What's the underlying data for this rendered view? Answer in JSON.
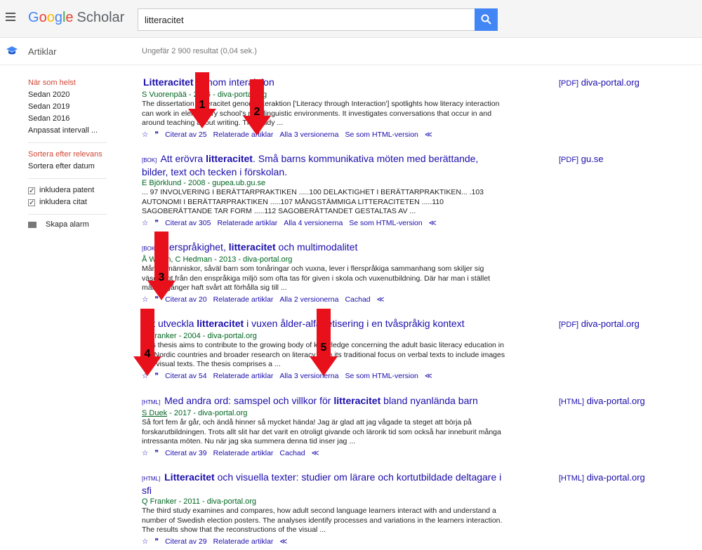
{
  "header": {
    "logo_google": [
      "G",
      "o",
      "o",
      "g",
      "l",
      "e"
    ],
    "logo_scholar": "Scholar",
    "search_value": "litteracitet"
  },
  "subheader": {
    "section": "Artiklar",
    "result_count": "Ungefär 2 900 resultat (0,04 sek.)"
  },
  "sidebar": {
    "time_filters": [
      "När som helst",
      "Sedan 2020",
      "Sedan 2019",
      "Sedan 2016",
      "Anpassat intervall ..."
    ],
    "sort_options": [
      "Sortera efter relevans",
      "Sortera efter datum"
    ],
    "checkboxes": [
      "inkludera patent",
      "inkludera citat"
    ],
    "alarm": "Skapa alarm"
  },
  "results": [
    {
      "tag": "",
      "title_pre": "",
      "title_bold": "Litteracitet",
      "title_post": " genom interaktion",
      "author": "S Vuorenpää - 2016 - diva-portal.org",
      "author_link": "",
      "snippet": "The dissertation Litteracitet genom interaktion ['Literacy through Interaction'] spotlights how literacy interaction can work in elementary school's multilinguistic environments. It investigates conversations that occur in and around teaching about writing. The study ...",
      "links": [
        "Citerat av 25",
        "Relaterade artiklar",
        "Alla 3 versionerna",
        "Se som HTML-version"
      ],
      "side_type": "[PDF]",
      "side_source": "diva-portal.org"
    },
    {
      "tag": "[BOK]",
      "title_pre": "Att erövra ",
      "title_bold": "litteracitet",
      "title_post": ". Små barns kommunikativa möten med berättande, bilder, text och tecken i förskolan.",
      "author": "E Björklund - 2008 - gupea.ub.gu.se",
      "author_link": "",
      "snippet": "... 97 INVOLVERING I BERÄTTARPRAKTIKEN .....100 DELAKTIGHET I BERÄTTARPRAKTIKEN... .103 AUTONOMI I BERÄTTARPRAKTIKEN .....107 MÅNGSTÄMMIGA LITTERACITETEN .....110 SAGOBERÄTTANDE TAR FORM .....112 SAGOBERÄTTANDET GESTALTAS AV ...",
      "links": [
        "Citerat av 305",
        "Relaterade artiklar",
        "Alla 4 versionerna",
        "Se som HTML-version"
      ],
      "side_type": "[PDF]",
      "side_source": "gu.se"
    },
    {
      "tag": "[BOK]",
      "title_pre": "Flerspråkighet, ",
      "title_bold": "litteracitet",
      "title_post": " och multimodalitet",
      "author": "Å Wedin, C Hedman - 2013 - diva-portal.org",
      "author_link": "",
      "snippet": "Många människor, såväl barn som tonåringar och vuxna, lever i flerspråkiga sammanhang som skiljer sig väsentligt från den enspråkiga miljö som ofta tas för given i skola och vuxenutbildning. Där har man i stället många gånger haft svårt att förhålla sig till ...",
      "links": [
        "Citerat av 20",
        "Relaterade artiklar",
        "Alla 2 versionerna",
        "Cachad"
      ],
      "side_type": "",
      "side_source": ""
    },
    {
      "tag": "",
      "title_pre": "Att utveckla ",
      "title_bold": "litteracitet",
      "title_post": " i vuxen ålder-alfabetisering i en tvåspråkig kontext",
      "author": "Q Franker - 2004 - diva-portal.org",
      "author_link": "",
      "snippet": "This thesis aims to contribute to the growing body of knowledge concerning the adult basic literacy education in the Nordic countries and broader research on literacy from its traditional focus on verbal texts to include images and visual texts. The thesis comprises a ...",
      "links": [
        "Citerat av 54",
        "Relaterade artiklar",
        "Alla 3 versionerna",
        "Se som HTML-version"
      ],
      "side_type": "[PDF]",
      "side_source": "diva-portal.org"
    },
    {
      "tag": "[HTML]",
      "title_pre": "Med andra ord: samspel och villkor för ",
      "title_bold": "litteracitet",
      "title_post": " bland nyanlända barn",
      "author": " - 2017 - diva-portal.org",
      "author_link": "S Duek",
      "snippet": "Så fort fem år går, och ändå hinner så mycket hända! Jag är glad att jag vågade ta steget att börja på forskarutbildningen. Trots allt slit har det varit en otroligt givande och lärorik tid som också har inneburit många intressanta möten. Nu när jag ska summera denna tid inser jag ...",
      "links": [
        "Citerat av 39",
        "Relaterade artiklar",
        "Cachad"
      ],
      "side_type": "[HTML]",
      "side_source": "diva-portal.org"
    },
    {
      "tag": "[HTML]",
      "title_pre": "",
      "title_bold": "Litteracitet",
      "title_post": " och visuella texter: studier om lärare och kortutbildade deltagare i sfi",
      "author": "Q Franker - 2011 - diva-portal.org",
      "author_link": "",
      "snippet": "The third study examines and compares, how adult second language learners interact with and understand a number of Swedish election posters. The analyses identify processes and variations in the learners interaction. The results show that the reconstructions of the visual ...",
      "links": [
        "Citerat av 29",
        "Relaterade artiklar"
      ],
      "side_type": "[HTML]",
      "side_source": "diva-portal.org"
    }
  ],
  "annotations": [
    "1",
    "2",
    "3",
    "4",
    "5"
  ],
  "colors": {
    "accent": "#4285f4",
    "link": "#1a0dab",
    "author": "#006621",
    "active": "#d14836",
    "arrow": "#e8101a"
  }
}
